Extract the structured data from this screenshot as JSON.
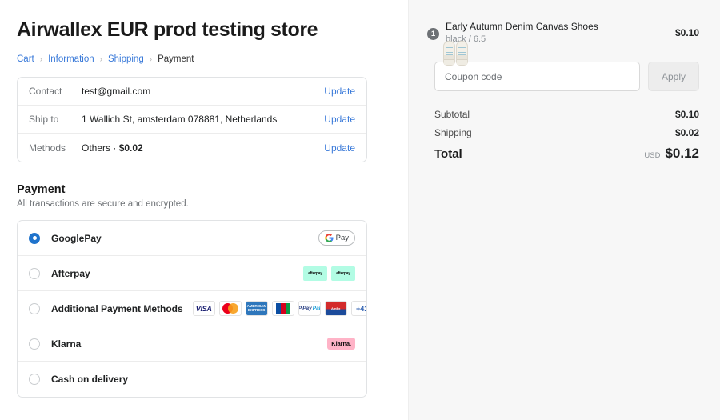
{
  "store": {
    "title": "Airwallex EUR prod testing store"
  },
  "breadcrumb": {
    "items": [
      {
        "label": "Cart",
        "current": false
      },
      {
        "label": "Information",
        "current": false
      },
      {
        "label": "Shipping",
        "current": false
      },
      {
        "label": "Payment",
        "current": true
      }
    ],
    "separator": "›"
  },
  "summary": {
    "rows": [
      {
        "label": "Contact",
        "value": "test@gmail.com",
        "value_bold": "",
        "action": "Update"
      },
      {
        "label": "Ship to",
        "value": "1 Wallich St, amsterdam 078881, Netherlands",
        "value_bold": "",
        "action": "Update"
      },
      {
        "label": "Methods",
        "value": "Others · ",
        "value_bold": "$0.02",
        "action": "Update"
      }
    ]
  },
  "payment": {
    "heading": "Payment",
    "subheading": "All transactions are secure and encrypted.",
    "methods": [
      {
        "label": "GooglePay",
        "selected": true,
        "badges": [
          "gpay"
        ]
      },
      {
        "label": "Afterpay",
        "selected": false,
        "badges": [
          "afterpay",
          "afterpay"
        ]
      },
      {
        "label": "Additional Payment Methods",
        "selected": false,
        "badges": [
          "visa",
          "mastercard",
          "amex",
          "jcb",
          "paypal",
          "amexred",
          "more"
        ],
        "more_label": "+41"
      },
      {
        "label": "Klarna",
        "selected": false,
        "badges": [
          "klarna"
        ]
      },
      {
        "label": "Cash on delivery",
        "selected": false,
        "badges": []
      }
    ],
    "badge_text": {
      "gpay": "Pay",
      "afterpay": "afterpay",
      "klarna": "Klarna.",
      "visa": "VISA",
      "amex": "AMERICAN EXPRESS",
      "paypal_p": "P",
      "paypal_a": "Pay",
      "paypal_b": "Pal",
      "amexred": "AmEx"
    }
  },
  "order": {
    "product": {
      "name": "Early Autumn Denim Canvas Shoes",
      "variant": "black / 6.5",
      "price": "$0.10",
      "quantity": "1"
    },
    "coupon": {
      "placeholder": "Coupon code",
      "value": "",
      "apply_label": "Apply"
    },
    "totals": [
      {
        "label": "Subtotal",
        "value": "$0.10"
      },
      {
        "label": "Shipping",
        "value": "$0.02"
      }
    ],
    "grand_total": {
      "label": "Total",
      "currency": "USD",
      "value": "$0.12"
    }
  },
  "colors": {
    "link": "#3a7ad9",
    "radio_selected": "#1f73cc",
    "panel_bg": "#f7f7f7",
    "afterpay_bg": "#b2fce4",
    "klarna_bg": "#ffb3c7",
    "thumb_bg": "#fcd083"
  }
}
